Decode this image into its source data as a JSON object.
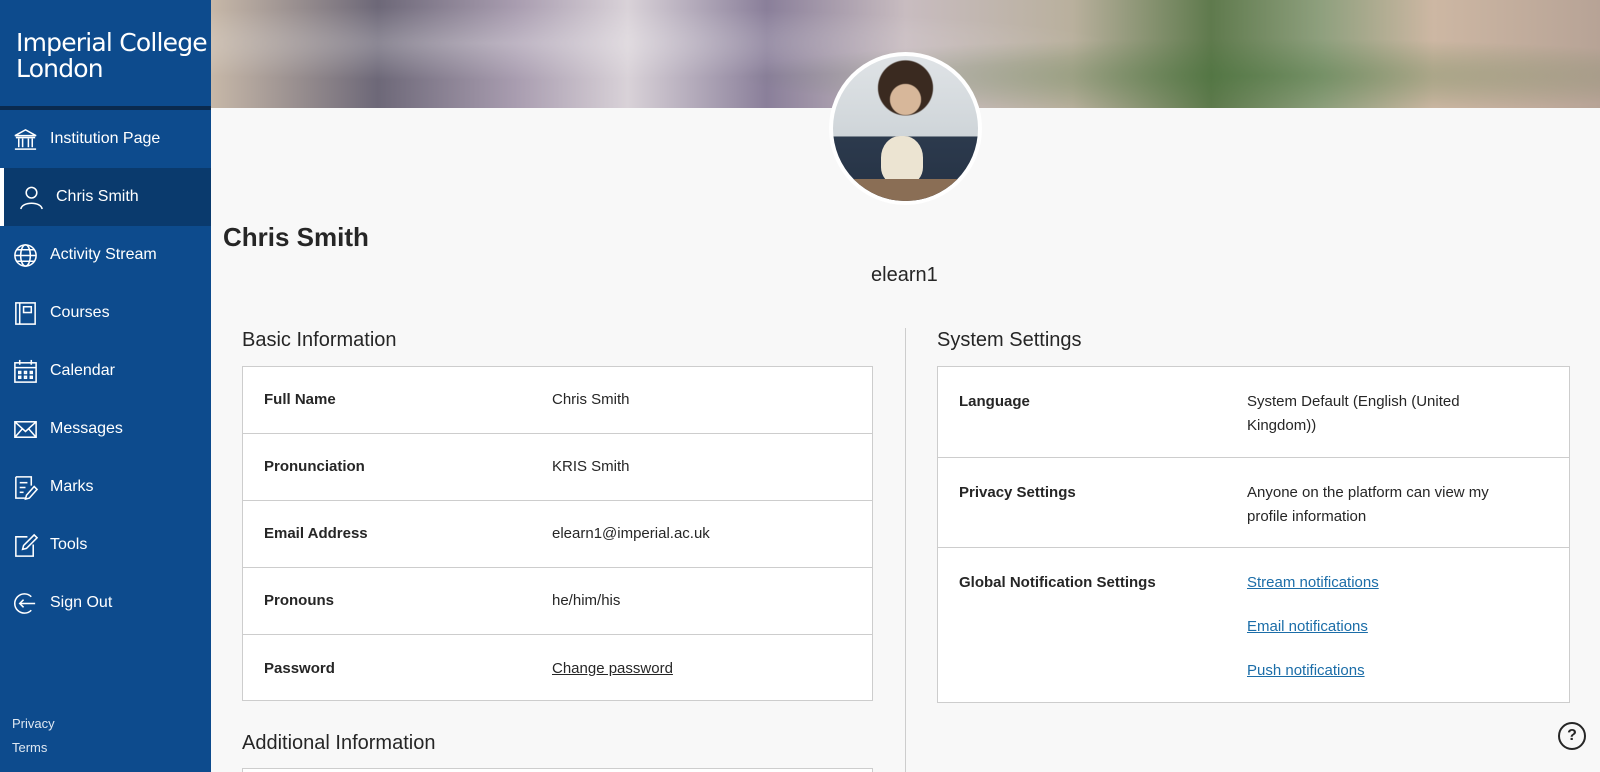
{
  "sidebar": {
    "logo_text": "Imperial College London",
    "items": [
      {
        "label": "Institution Page",
        "icon": "institution-icon"
      },
      {
        "label": "Chris Smith",
        "icon": "user-icon",
        "active": true
      },
      {
        "label": "Activity Stream",
        "icon": "globe-icon"
      },
      {
        "label": "Courses",
        "icon": "courses-icon"
      },
      {
        "label": "Calendar",
        "icon": "calendar-icon"
      },
      {
        "label": "Messages",
        "icon": "envelope-icon"
      },
      {
        "label": "Marks",
        "icon": "marks-icon"
      },
      {
        "label": "Tools",
        "icon": "tools-icon"
      },
      {
        "label": "Sign Out",
        "icon": "sign-out-icon"
      }
    ],
    "footer": {
      "privacy": "Privacy",
      "terms": "Terms"
    }
  },
  "profile": {
    "name": "Chris Smith",
    "username": "elearn1"
  },
  "basic_info": {
    "title": "Basic Information",
    "rows": [
      {
        "label": "Full Name",
        "value": "Chris Smith"
      },
      {
        "label": "Pronunciation",
        "value": "KRIS Smith"
      },
      {
        "label": "Email Address",
        "value": "elearn1@imperial.ac.uk"
      },
      {
        "label": "Pronouns",
        "value": "he/him/his"
      },
      {
        "label": "Password",
        "value": "Change password"
      }
    ]
  },
  "additional_info": {
    "title": "Additional Information"
  },
  "system_settings": {
    "title": "System Settings",
    "language_label": "Language",
    "language_value": "System Default (English (United Kingdom))",
    "privacy_label": "Privacy Settings",
    "privacy_value": "Anyone on the platform can view my profile information",
    "notif_label": "Global Notification Settings",
    "notif_links": [
      "Stream notifications",
      "Email notifications",
      "Push notifications"
    ]
  },
  "help_label": "?",
  "colors": {
    "sidebar": "#0d4b8d",
    "link": "#1b6da8"
  }
}
